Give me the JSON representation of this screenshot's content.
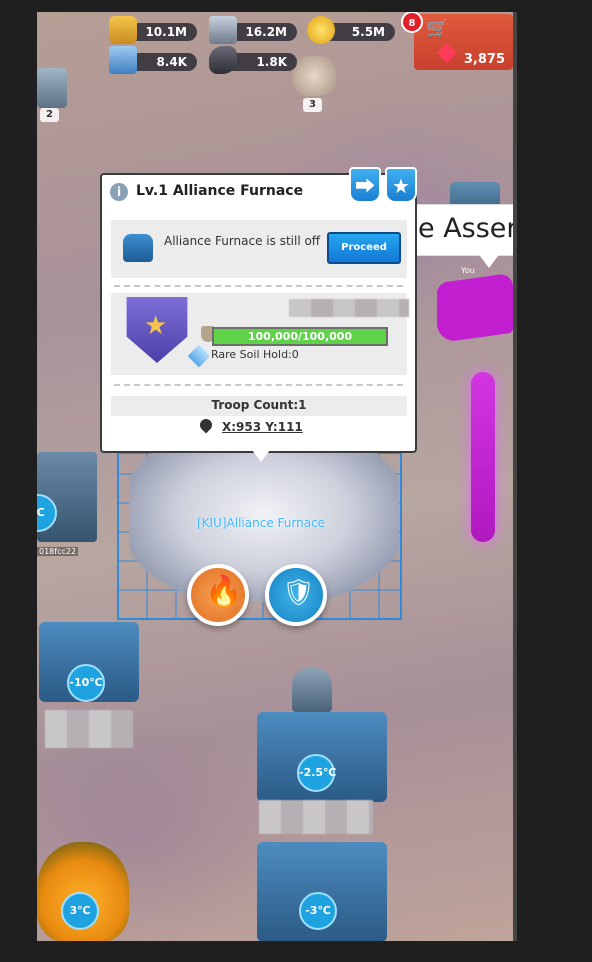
{
  "resources": [
    {
      "icon": "bread-icon",
      "value": "10.1M"
    },
    {
      "icon": "iron-icon",
      "value": "16.2M"
    },
    {
      "icon": "gold-coin-icon",
      "value": "5.5M"
    },
    {
      "icon": "steel-icon",
      "value": "8.4K"
    },
    {
      "icon": "ore-icon",
      "value": "1.8K"
    }
  ],
  "shop": {
    "badge": "8",
    "gems": "3,875"
  },
  "map": {
    "level_tags": [
      "2",
      "3",
      "3"
    ],
    "temperatures": [
      "-10℃",
      "-2.5℃",
      "3℃",
      "-3℃"
    ],
    "furnace_label": "[KIU]Alliance Furnace",
    "partial_banner": "e Asser",
    "partial_player": "018fcc22",
    "partial_left_temp": "℃",
    "partial_small": "You"
  },
  "popup": {
    "title": "Lv.1 Alliance Furnace",
    "status_text": "Alliance Furnace is still off",
    "proceed_label": "Proceed",
    "progress_text": "100,000/100,000",
    "progress_fraction": 1.0,
    "rare_soil": "Rare Soil Hold:0",
    "troop_count": "Troop Count:1",
    "coords": "X:953 Y:111"
  },
  "colors": {
    "proceed": "#1b8fe3",
    "progress_fill": "#5fd24a",
    "temp_badge": "#1fa3e0",
    "fire_button": "#f08a3a",
    "shield_button": "#1f9fd6",
    "magenta_flag": "#c21fd1"
  }
}
